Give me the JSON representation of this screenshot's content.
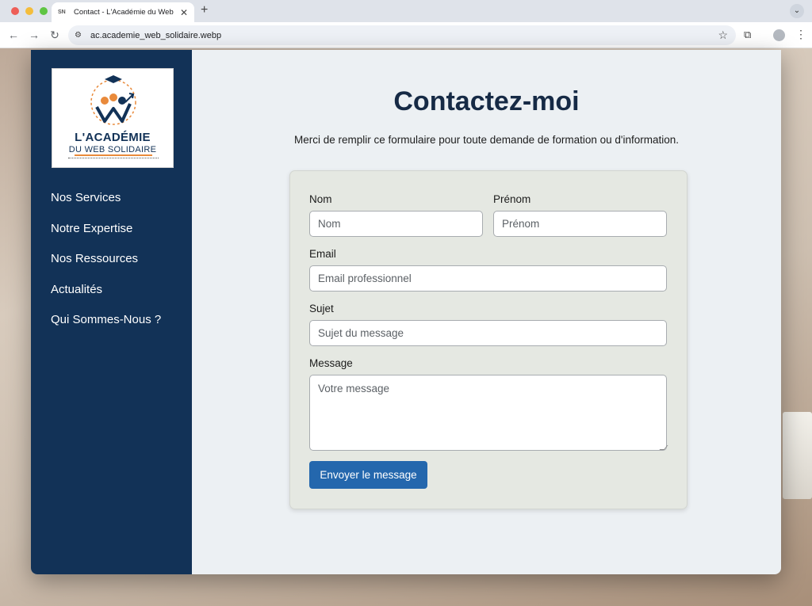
{
  "browser": {
    "tab_title": "Contact - L'Académie du Web",
    "tab_favicon": "SN",
    "url": "ac.academie_web_solidaire.webp"
  },
  "logo": {
    "line1": "L'ACADÉMIE",
    "line2": "DU WEB SOLIDAIRE",
    "accent_color": "#e98a3b",
    "brand_color": "#123257"
  },
  "sidebar": {
    "items": [
      {
        "label": "Nos Services"
      },
      {
        "label": "Notre Expertise"
      },
      {
        "label": "Nos Ressources"
      },
      {
        "label": "Actualités"
      },
      {
        "label": "Qui Sommes-Nous ?"
      }
    ]
  },
  "page": {
    "title": "Contactez-moi",
    "subtitle": "Merci de remplir ce formulaire pour toute demande de formation ou d'information."
  },
  "form": {
    "nom": {
      "label": "Nom",
      "placeholder": "Nom",
      "value": ""
    },
    "prenom": {
      "label": "Prénom",
      "placeholder": "Prénom",
      "value": ""
    },
    "email": {
      "label": "Email",
      "placeholder": "Email professionnel",
      "value": ""
    },
    "sujet": {
      "label": "Sujet",
      "placeholder": "Sujet du message",
      "value": ""
    },
    "message": {
      "label": "Message",
      "placeholder": "Votre message",
      "value": ""
    },
    "submit_label": "Envoyer le message",
    "submit_color": "#2467ad"
  }
}
